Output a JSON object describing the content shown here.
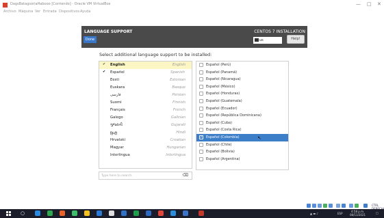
{
  "window": {
    "title": "DagsBatagsoriaHabooo [Corriendo] - Oracle VM VirtualBox",
    "menu": [
      "Archivo",
      "Máquina",
      "Ver",
      "Entrada",
      "Dispositivos",
      "Ayuda"
    ],
    "controls": {
      "minimize": "—",
      "maximize": "□",
      "close": "✕"
    }
  },
  "installer": {
    "section_title": "LANGUAGE SUPPORT",
    "product_title": "CENTOS 7 INSTALLATION",
    "done_label": "Done",
    "keyboard_value": "us",
    "help_label": "Help!",
    "prompt": "Select additional language support to be installed:"
  },
  "languages": [
    {
      "native": "English",
      "english": "English",
      "state": "added"
    },
    {
      "native": "Español",
      "english": "Spanish",
      "state": "selected"
    },
    {
      "native": "Eesti",
      "english": "Estonian",
      "state": ""
    },
    {
      "native": "Euskara",
      "english": "Basque",
      "state": ""
    },
    {
      "native": "فارسی",
      "english": "Persian",
      "state": ""
    },
    {
      "native": "Suomi",
      "english": "Finnish",
      "state": ""
    },
    {
      "native": "Français",
      "english": "French",
      "state": ""
    },
    {
      "native": "Galego",
      "english": "Galician",
      "state": ""
    },
    {
      "native": "ગુજરાતી",
      "english": "Gujarati",
      "state": ""
    },
    {
      "native": "हिन्दी",
      "english": "Hindi",
      "state": ""
    },
    {
      "native": "Hrvatski",
      "english": "Croatian",
      "state": ""
    },
    {
      "native": "Magyar",
      "english": "Hungarian",
      "state": ""
    },
    {
      "native": "Interlingua",
      "english": "Interlingua",
      "state": ""
    }
  ],
  "check_marks": {
    "added": "✔",
    "selected": "✔",
    "arrow": "❯",
    "box_checked": "✓"
  },
  "search": {
    "placeholder": "Type here to search.",
    "clear_icon": "⌫"
  },
  "locales": [
    {
      "label": "Español (Perú)",
      "checked": false
    },
    {
      "label": "Español (Panamá)",
      "checked": false
    },
    {
      "label": "Español (Nicaragua)",
      "checked": false
    },
    {
      "label": "Español (México)",
      "checked": false
    },
    {
      "label": "Español (Honduras)",
      "checked": false
    },
    {
      "label": "Español (Guatemala)",
      "checked": false
    },
    {
      "label": "Español (Ecuador)",
      "checked": false
    },
    {
      "label": "Español (República Dominicana)",
      "checked": false
    },
    {
      "label": "Español (Cuba)",
      "checked": false
    },
    {
      "label": "Español (Costa Rica)",
      "checked": false
    },
    {
      "label": "Español (Colombia)",
      "checked": true
    },
    {
      "label": "Español (Chile)",
      "checked": false
    },
    {
      "label": "Español (Bolivia)",
      "checked": false
    },
    {
      "label": "Español (Argentina)",
      "checked": false
    }
  ],
  "statusbar": {
    "host_key": "CTRL DERECHA"
  },
  "taskbar": {
    "time": "4:58 p.m.",
    "date": "08/11/2021",
    "lang": "ESP"
  },
  "colors": {
    "accent": "#3d7ec9",
    "header": "#4a4a4a",
    "added_bg": "#fbf6c4",
    "taskbar": "#1b1e2a"
  }
}
